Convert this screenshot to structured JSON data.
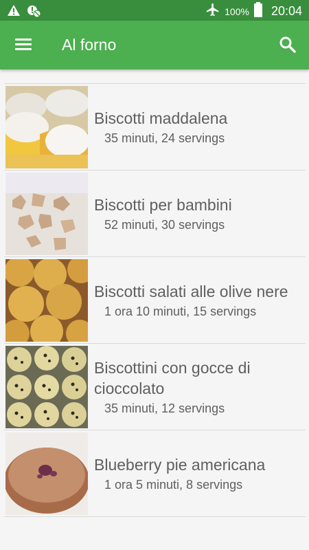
{
  "status_bar": {
    "battery_percent": "100%",
    "time": "20:04",
    "icons": [
      "warning-icon",
      "blocked-notification-icon",
      "airplane-mode-icon",
      "battery-icon"
    ]
  },
  "app_bar": {
    "title": "Al forno",
    "icons": [
      "menu-icon",
      "search-icon"
    ]
  },
  "recipes": [
    {
      "title": "Biscotti maddalena",
      "meta": "35 minuti, 24 servings"
    },
    {
      "title": "Biscotti per bambini",
      "meta": "52 minuti, 30 servings"
    },
    {
      "title": "Biscotti salati alle olive nere",
      "meta": "1 ora 10 minuti, 15 servings"
    },
    {
      "title": "Biscottini con gocce di cioccolato",
      "meta": "35 minuti, 12 servings"
    },
    {
      "title": "Blueberry pie americana",
      "meta": "1 ora 5 minuti, 8 servings"
    }
  ],
  "colors": {
    "status_bar": "#388e3c",
    "app_bar": "#4caf50",
    "text": "#5f5f5f"
  }
}
